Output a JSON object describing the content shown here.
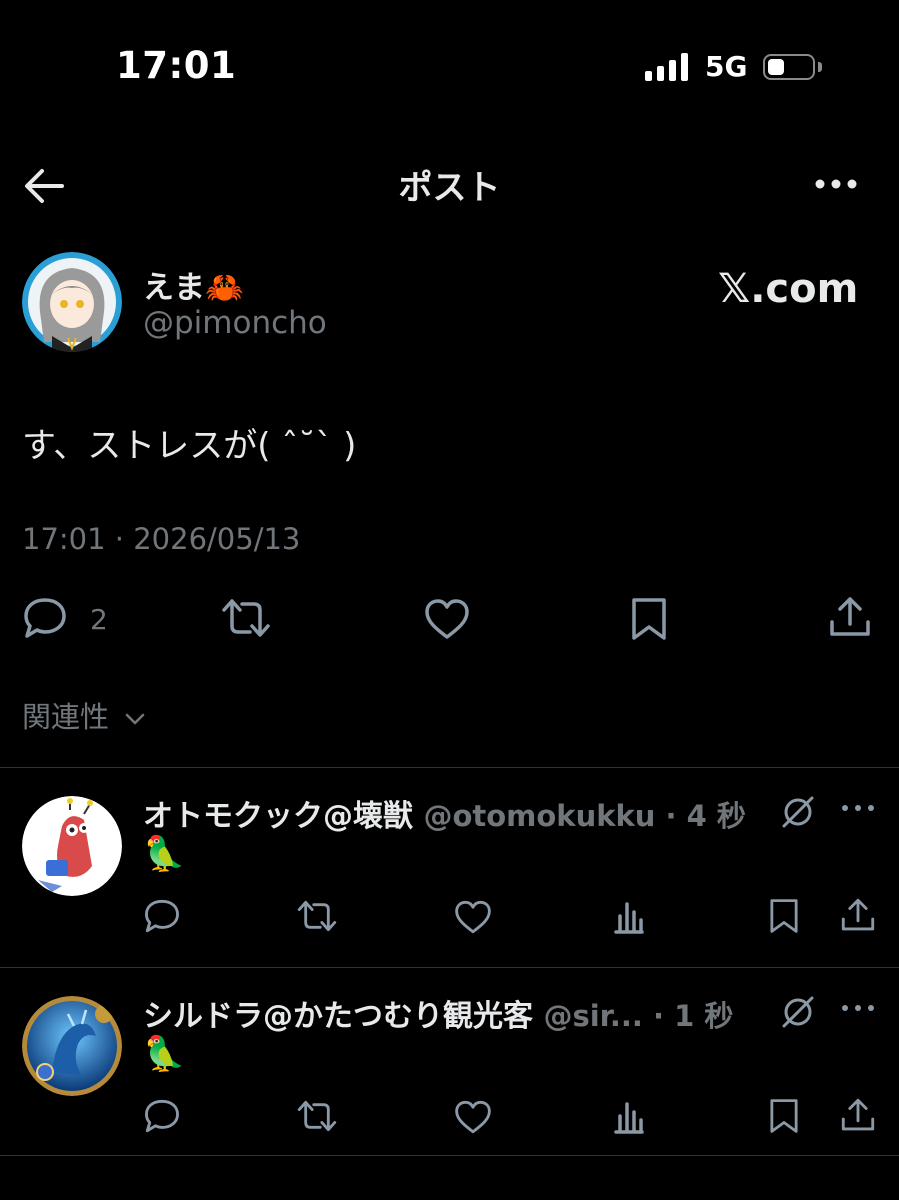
{
  "status_bar": {
    "time": "17:01",
    "network": "5G"
  },
  "header": {
    "title": "ポスト"
  },
  "post": {
    "author_name": "えま🦀",
    "author_handle": "@pimoncho",
    "source_label": "𝕏.com",
    "text": "す、ストレスが( ˆ˘ˋ )",
    "timestamp": "17:01 · 2026/05/13",
    "reply_count": "2"
  },
  "replies_sort": {
    "label": "関連性"
  },
  "replies": [
    {
      "name": "オトモクック@壊獣",
      "handle": "@otomokukku · 4 秒",
      "text": "🦜"
    },
    {
      "name": "シルドラ@かたつむり観光客",
      "handle": "@sir... · 1 秒",
      "text": "🦜"
    }
  ],
  "colors": {
    "background": "#000000",
    "text": "#e7e9ea",
    "muted": "#71767b",
    "divider": "#2f3336"
  },
  "icons": [
    "back-arrow-icon",
    "more-icon",
    "reply-icon",
    "retweet-icon",
    "like-icon",
    "bookmark-icon",
    "share-icon",
    "chevron-down-icon",
    "views-icon",
    "grok-icon"
  ]
}
